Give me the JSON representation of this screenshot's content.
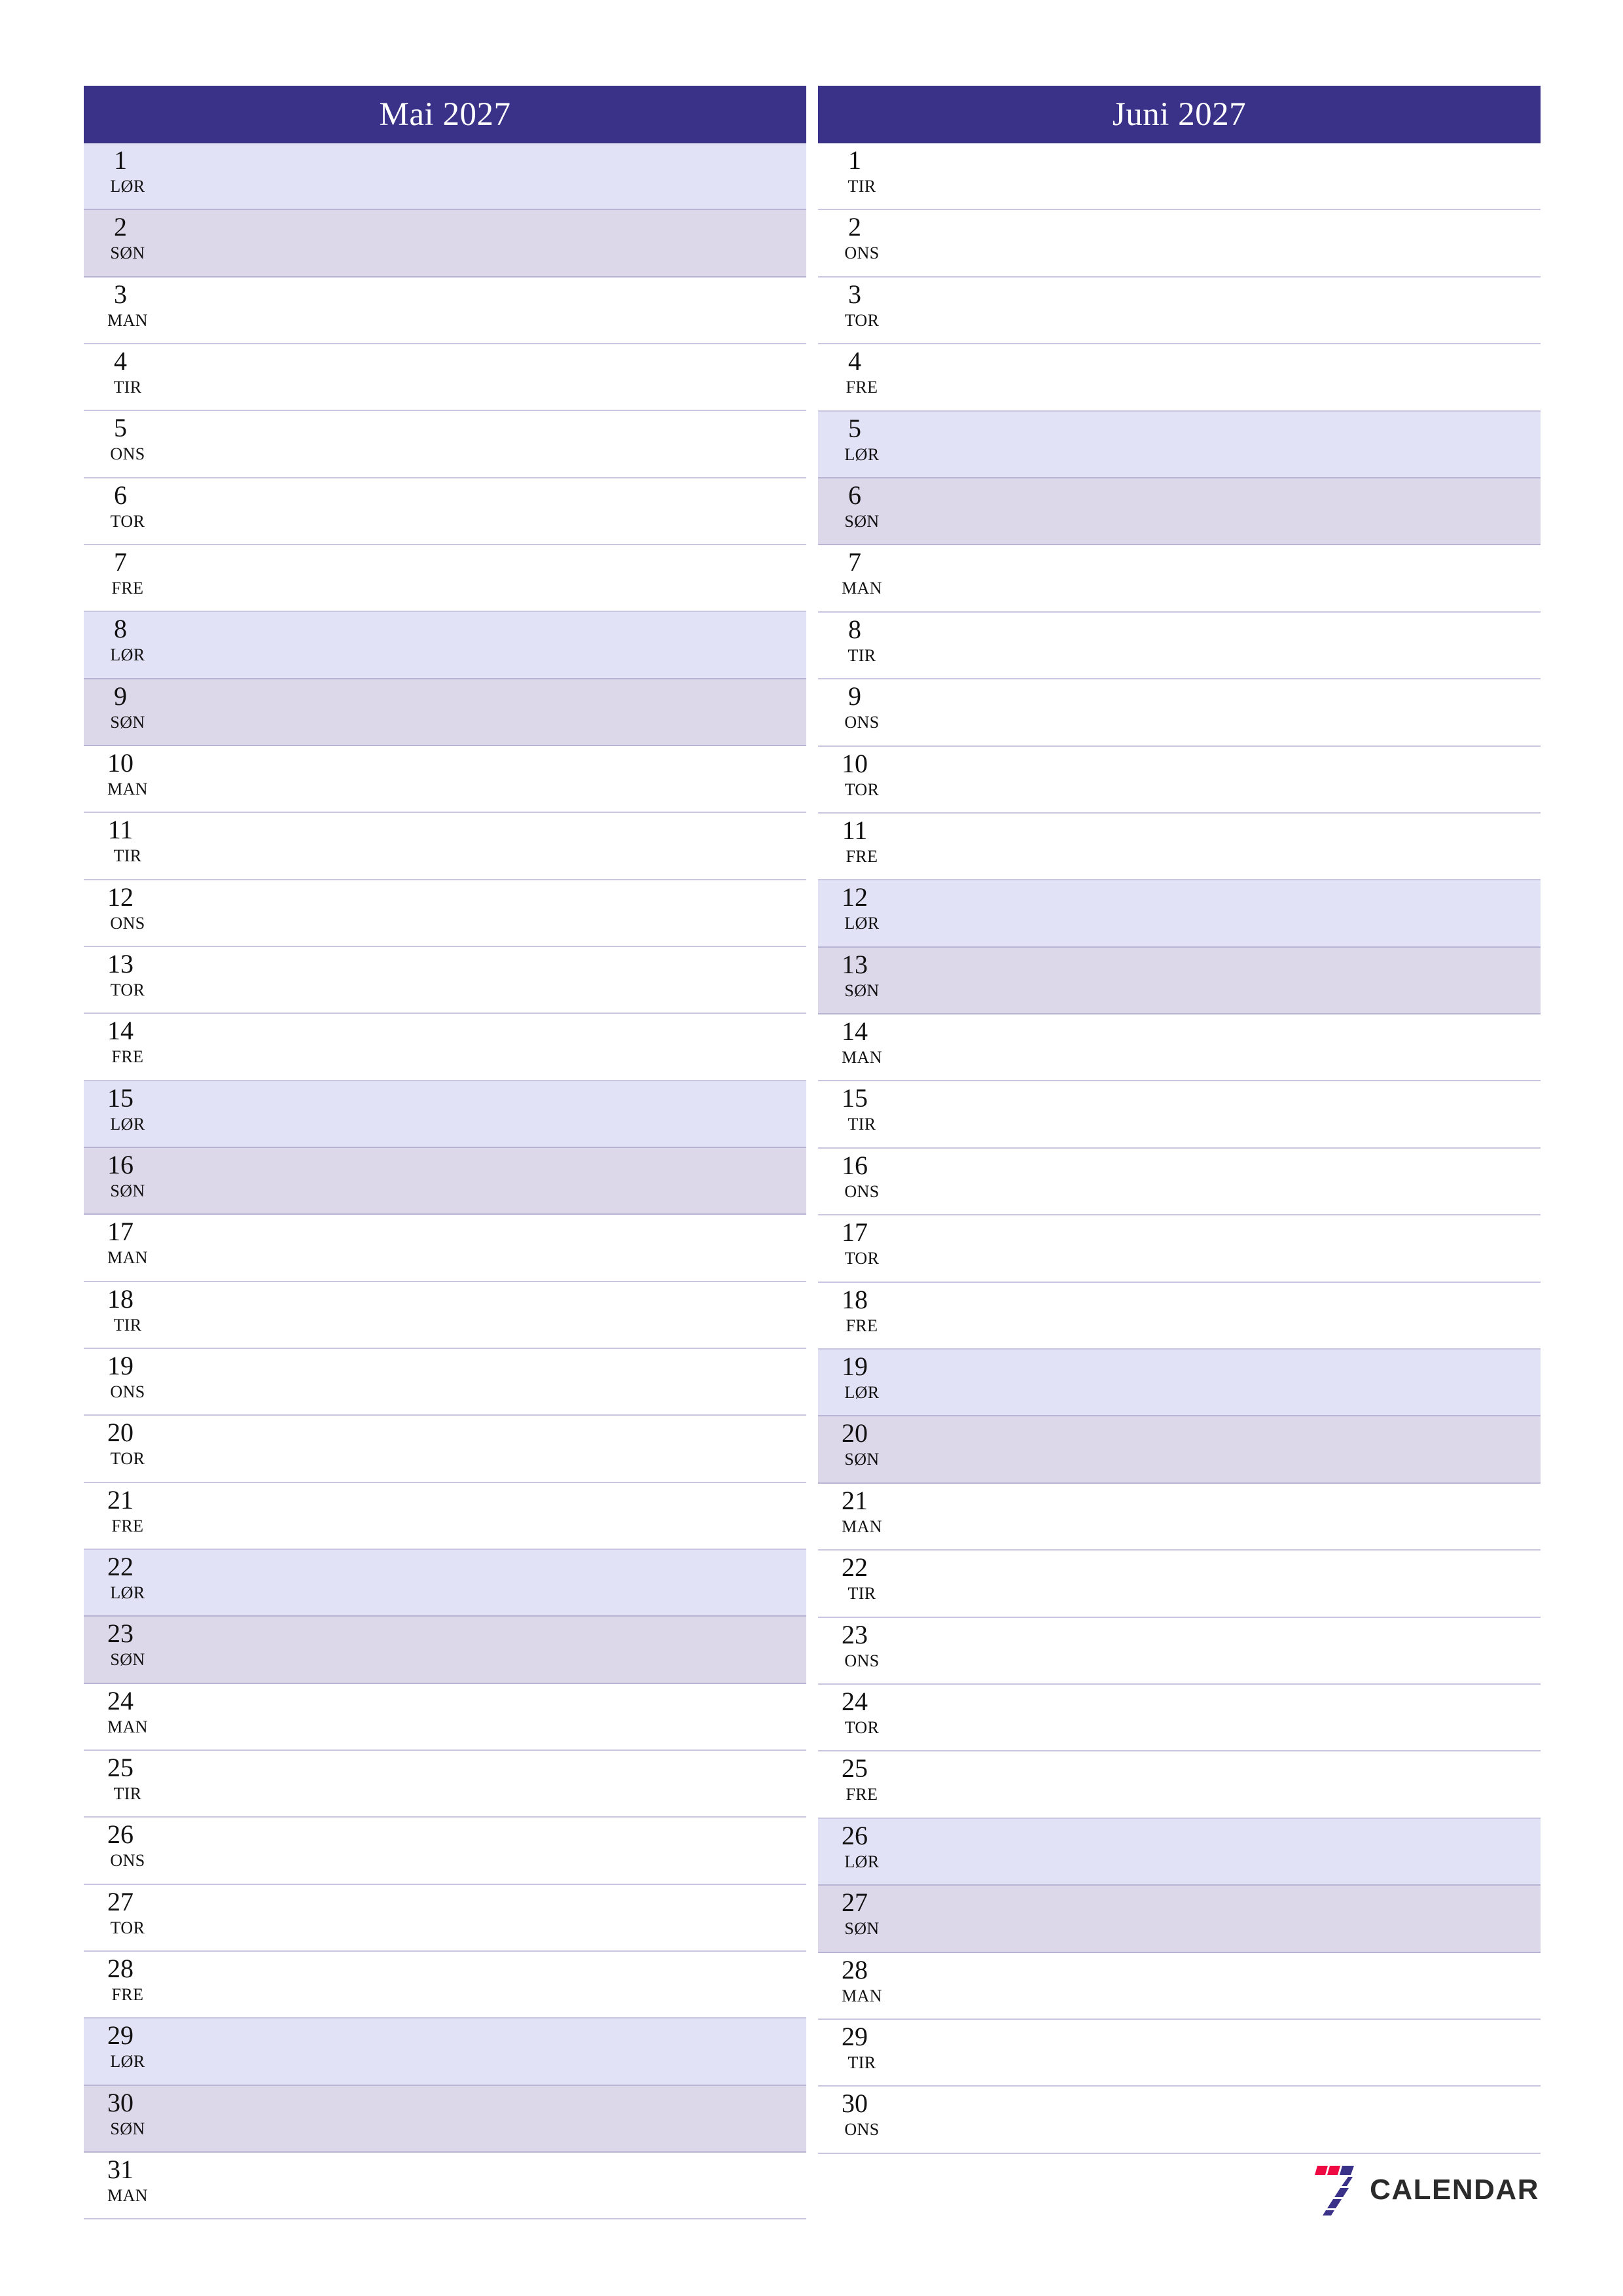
{
  "document": {
    "type": "monthly-planner",
    "orientation": "portrait",
    "language": "no"
  },
  "colors": {
    "header_bg": "#3a3288",
    "header_text": "#ffffff",
    "saturday_bg": "#e2e2f6",
    "sunday_bg": "#dcd8ea",
    "row_border": "#c8c6e0",
    "brand_blue": "#3a3288",
    "brand_red": "#ee0b43",
    "brand_text": "#2b2b2b"
  },
  "brand": {
    "name": "CALENDAR",
    "mark": "seven-logo-icon"
  },
  "months": [
    {
      "id": "may",
      "title": "Mai 2027",
      "days": [
        {
          "num": "1",
          "name": "LØR",
          "type": "sat"
        },
        {
          "num": "2",
          "name": "SØN",
          "type": "sun"
        },
        {
          "num": "3",
          "name": "MAN",
          "type": "weekday"
        },
        {
          "num": "4",
          "name": "TIR",
          "type": "weekday"
        },
        {
          "num": "5",
          "name": "ONS",
          "type": "weekday"
        },
        {
          "num": "6",
          "name": "TOR",
          "type": "weekday"
        },
        {
          "num": "7",
          "name": "FRE",
          "type": "weekday"
        },
        {
          "num": "8",
          "name": "LØR",
          "type": "sat"
        },
        {
          "num": "9",
          "name": "SØN",
          "type": "sun"
        },
        {
          "num": "10",
          "name": "MAN",
          "type": "weekday"
        },
        {
          "num": "11",
          "name": "TIR",
          "type": "weekday"
        },
        {
          "num": "12",
          "name": "ONS",
          "type": "weekday"
        },
        {
          "num": "13",
          "name": "TOR",
          "type": "weekday"
        },
        {
          "num": "14",
          "name": "FRE",
          "type": "weekday"
        },
        {
          "num": "15",
          "name": "LØR",
          "type": "sat"
        },
        {
          "num": "16",
          "name": "SØN",
          "type": "sun"
        },
        {
          "num": "17",
          "name": "MAN",
          "type": "weekday"
        },
        {
          "num": "18",
          "name": "TIR",
          "type": "weekday"
        },
        {
          "num": "19",
          "name": "ONS",
          "type": "weekday"
        },
        {
          "num": "20",
          "name": "TOR",
          "type": "weekday"
        },
        {
          "num": "21",
          "name": "FRE",
          "type": "weekday"
        },
        {
          "num": "22",
          "name": "LØR",
          "type": "sat"
        },
        {
          "num": "23",
          "name": "SØN",
          "type": "sun"
        },
        {
          "num": "24",
          "name": "MAN",
          "type": "weekday"
        },
        {
          "num": "25",
          "name": "TIR",
          "type": "weekday"
        },
        {
          "num": "26",
          "name": "ONS",
          "type": "weekday"
        },
        {
          "num": "27",
          "name": "TOR",
          "type": "weekday"
        },
        {
          "num": "28",
          "name": "FRE",
          "type": "weekday"
        },
        {
          "num": "29",
          "name": "LØR",
          "type": "sat"
        },
        {
          "num": "30",
          "name": "SØN",
          "type": "sun"
        },
        {
          "num": "31",
          "name": "MAN",
          "type": "weekday"
        }
      ]
    },
    {
      "id": "june",
      "title": "Juni 2027",
      "days": [
        {
          "num": "1",
          "name": "TIR",
          "type": "weekday"
        },
        {
          "num": "2",
          "name": "ONS",
          "type": "weekday"
        },
        {
          "num": "3",
          "name": "TOR",
          "type": "weekday"
        },
        {
          "num": "4",
          "name": "FRE",
          "type": "weekday"
        },
        {
          "num": "5",
          "name": "LØR",
          "type": "sat"
        },
        {
          "num": "6",
          "name": "SØN",
          "type": "sun"
        },
        {
          "num": "7",
          "name": "MAN",
          "type": "weekday"
        },
        {
          "num": "8",
          "name": "TIR",
          "type": "weekday"
        },
        {
          "num": "9",
          "name": "ONS",
          "type": "weekday"
        },
        {
          "num": "10",
          "name": "TOR",
          "type": "weekday"
        },
        {
          "num": "11",
          "name": "FRE",
          "type": "weekday"
        },
        {
          "num": "12",
          "name": "LØR",
          "type": "sat"
        },
        {
          "num": "13",
          "name": "SØN",
          "type": "sun"
        },
        {
          "num": "14",
          "name": "MAN",
          "type": "weekday"
        },
        {
          "num": "15",
          "name": "TIR",
          "type": "weekday"
        },
        {
          "num": "16",
          "name": "ONS",
          "type": "weekday"
        },
        {
          "num": "17",
          "name": "TOR",
          "type": "weekday"
        },
        {
          "num": "18",
          "name": "FRE",
          "type": "weekday"
        },
        {
          "num": "19",
          "name": "LØR",
          "type": "sat"
        },
        {
          "num": "20",
          "name": "SØN",
          "type": "sun"
        },
        {
          "num": "21",
          "name": "MAN",
          "type": "weekday"
        },
        {
          "num": "22",
          "name": "TIR",
          "type": "weekday"
        },
        {
          "num": "23",
          "name": "ONS",
          "type": "weekday"
        },
        {
          "num": "24",
          "name": "TOR",
          "type": "weekday"
        },
        {
          "num": "25",
          "name": "FRE",
          "type": "weekday"
        },
        {
          "num": "26",
          "name": "LØR",
          "type": "sat"
        },
        {
          "num": "27",
          "name": "SØN",
          "type": "sun"
        },
        {
          "num": "28",
          "name": "MAN",
          "type": "weekday"
        },
        {
          "num": "29",
          "name": "TIR",
          "type": "weekday"
        },
        {
          "num": "30",
          "name": "ONS",
          "type": "weekday"
        },
        {
          "num": "",
          "name": "",
          "type": "blank"
        }
      ]
    }
  ]
}
